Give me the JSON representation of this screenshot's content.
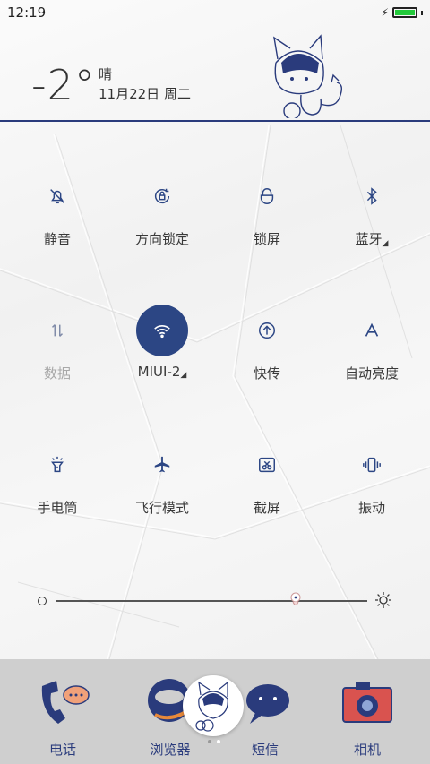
{
  "status": {
    "time": "12:19",
    "battery_level": 1.0
  },
  "weather": {
    "temperature": "-2°",
    "condition": "晴",
    "date": "11月22日 周二"
  },
  "toggles": [
    {
      "label": "静音",
      "icon": "bell-off-icon",
      "state": "off"
    },
    {
      "label": "方向锁定",
      "icon": "rotation-lock-icon",
      "state": "off"
    },
    {
      "label": "锁屏",
      "icon": "lock-icon",
      "state": "off"
    },
    {
      "label": "蓝牙",
      "icon": "bluetooth-icon",
      "state": "off",
      "has_menu": true
    },
    {
      "label": "数据",
      "icon": "mobile-data-icon",
      "state": "disabled"
    },
    {
      "label": "MIUI-2",
      "icon": "wifi-icon",
      "state": "on",
      "has_menu": true
    },
    {
      "label": "快传",
      "icon": "quick-transfer-icon",
      "state": "off"
    },
    {
      "label": "自动亮度",
      "icon": "auto-brightness-icon",
      "state": "off"
    },
    {
      "label": "手电筒",
      "icon": "flashlight-icon",
      "state": "off"
    },
    {
      "label": "飞行模式",
      "icon": "airplane-icon",
      "state": "off"
    },
    {
      "label": "截屏",
      "icon": "screenshot-icon",
      "state": "off"
    },
    {
      "label": "振动",
      "icon": "vibrate-icon",
      "state": "off"
    }
  ],
  "brightness": {
    "level": 0.77
  },
  "dock": [
    {
      "label": "电话",
      "icon": "phone-icon"
    },
    {
      "label": "浏览器",
      "icon": "browser-icon"
    },
    {
      "label": "短信",
      "icon": "message-icon"
    },
    {
      "label": "相机",
      "icon": "camera-icon"
    }
  ],
  "colors": {
    "accent": "#2c4684",
    "battery": "#22c93a",
    "dock_label": "#2a3b7c"
  }
}
